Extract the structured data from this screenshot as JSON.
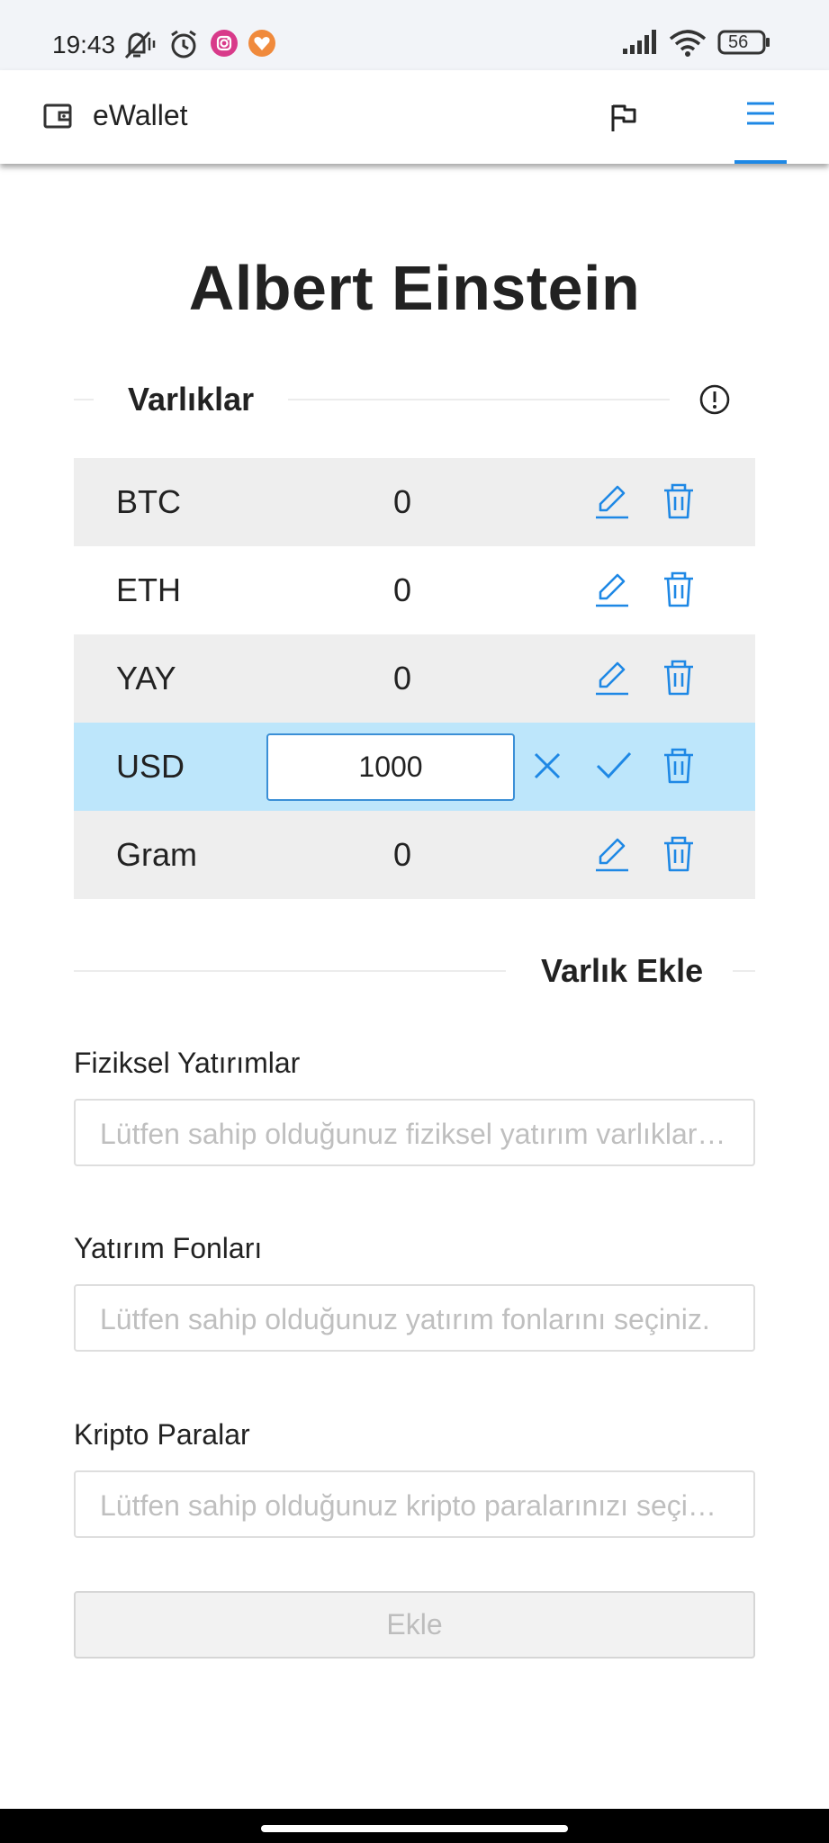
{
  "status_bar": {
    "time": "19:43",
    "battery": "56"
  },
  "app_bar": {
    "title": "eWallet"
  },
  "page": {
    "title": "Albert Einstein"
  },
  "assets_section": {
    "heading": "Varlıklar"
  },
  "assets": [
    {
      "name": "BTC",
      "value": "0"
    },
    {
      "name": "ETH",
      "value": "0"
    },
    {
      "name": "YAY",
      "value": "0"
    },
    {
      "name": "USD",
      "value": "1000"
    },
    {
      "name": "Gram",
      "value": "0"
    }
  ],
  "add_section": {
    "heading": "Varlık Ekle",
    "physical": {
      "label": "Fiziksel Yatırımlar",
      "placeholder": "Lütfen sahip olduğunuz fiziksel yatırım varlıklarınızı seçiniz."
    },
    "funds": {
      "label": "Yatırım Fonları",
      "placeholder": "Lütfen sahip olduğunuz yatırım fonlarını seçiniz."
    },
    "crypto": {
      "label": "Kripto Paralar",
      "placeholder": "Lütfen sahip olduğunuz kripto paralarınızı seçiniz."
    },
    "submit_label": "Ekle"
  },
  "colors": {
    "accent": "#1e88e5",
    "editing_row": "#bde6fb",
    "shaded_row": "#eeeeee"
  }
}
